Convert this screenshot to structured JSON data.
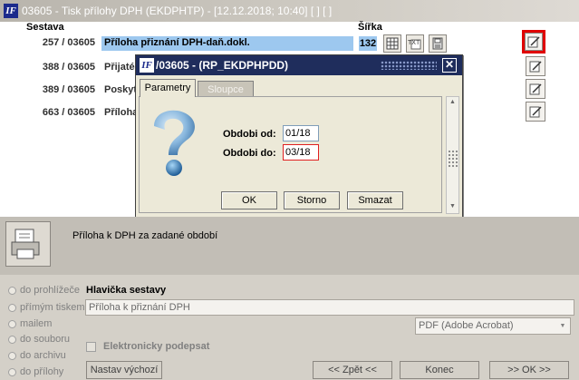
{
  "window": {
    "title": "03605 - Tisk přílohy DPH (EKDPHTP) - [12.12.2018; 10:40]  [ ]  [ ]",
    "logo": "IF"
  },
  "list": {
    "col_sestava": "Sestava",
    "col_sirka": "Šířka",
    "rows": [
      {
        "id": "257 / 03605",
        "name": "Příloha přiznání DPH-daň.dokl.",
        "width": "132"
      },
      {
        "id": "388 / 03605",
        "name": "Přijaté za"
      },
      {
        "id": "389 / 03605",
        "name": "Poskytn"
      },
      {
        "id": "663 / 03605",
        "name": "Příloha"
      }
    ],
    "toolbar_icons": [
      "table-icon",
      "text-icon",
      "disk-icon"
    ],
    "edit_icon": "edit-report-icon"
  },
  "dialog": {
    "logo": "IF",
    "title": "/03605 - (RP_EKDPHPDD)",
    "close_label": "✕",
    "tabs": {
      "parametry": "Parametry",
      "sloupce": "Sloupce"
    },
    "icon": "question-mark-icon",
    "obdobi_od_label": "Obdobi od:",
    "obdobi_od_value": "01/18",
    "obdobi_do_label": "Obdobi do:",
    "obdobi_do_value": "03/18",
    "ok_label": "OK",
    "storno_label": "Storno",
    "smazat_label": "Smazat"
  },
  "info": {
    "icon": "printer-icon",
    "description": "Příloha k DPH za zadané období"
  },
  "output": {
    "options": [
      "do prohlížeče",
      "přímým tiskem",
      "mailem",
      "do souboru",
      "do archivu",
      "do přílohy"
    ],
    "header_label": "Hlavička sestavy",
    "header_value": "Příloha k přiznání DPH",
    "format_value": "PDF (Adobe Acrobat)",
    "esign_label": "Elektronicky podepsat",
    "default_label": "Nastav výchozí",
    "back_label": "<< Zpět <<",
    "end_label": "Konec",
    "ok_label": ">> OK >>"
  },
  "colors": {
    "accent_red": "#e00000",
    "selection": "#9dc8ef",
    "dialog_title": "#1f2d5c"
  }
}
